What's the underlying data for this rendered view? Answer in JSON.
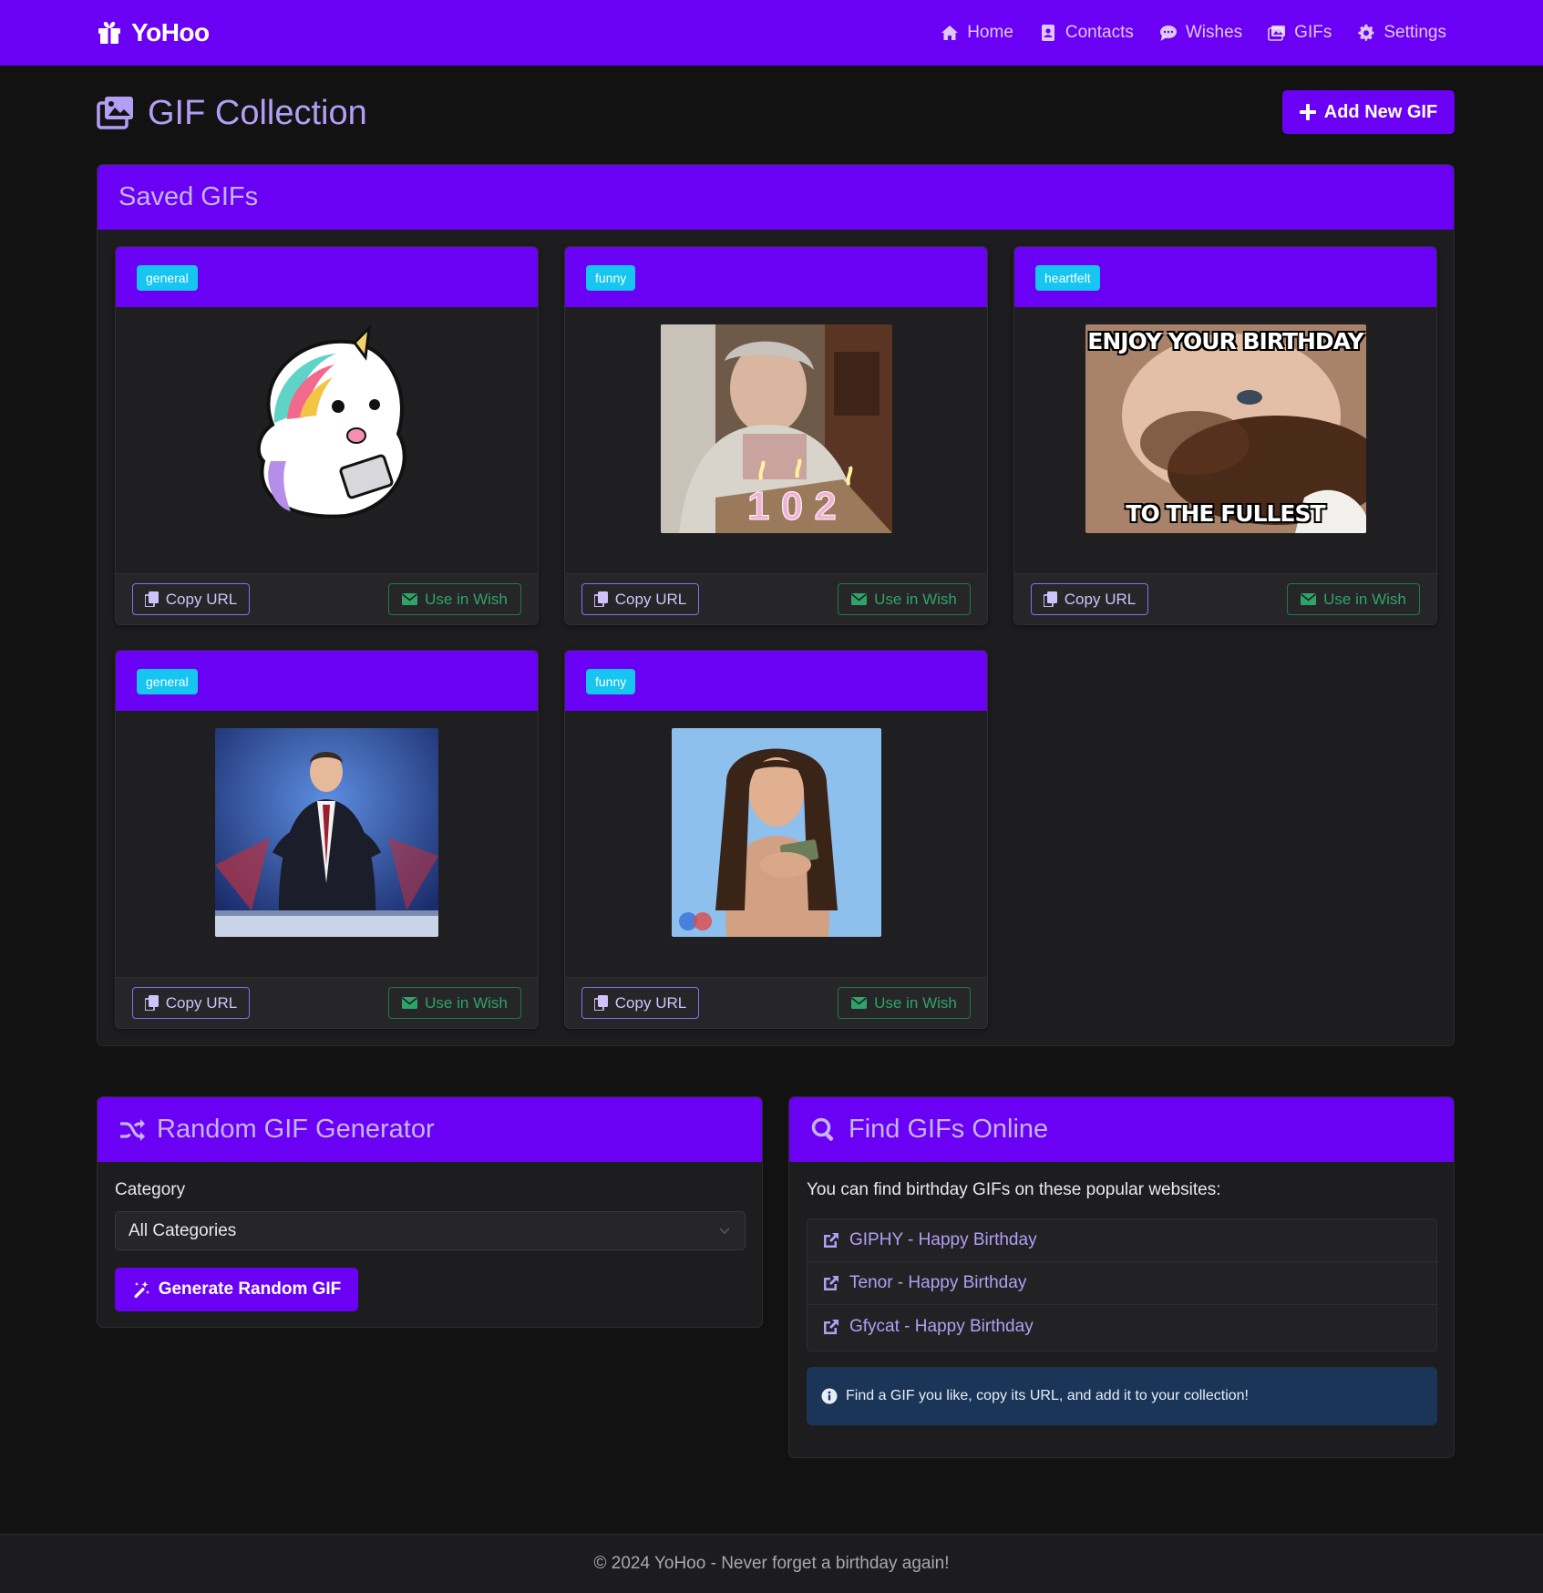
{
  "app": {
    "brand": "YoHoo",
    "brand_icon": "gift-icon"
  },
  "nav": {
    "items": [
      {
        "label": "Home",
        "icon": "home-icon"
      },
      {
        "label": "Contacts",
        "icon": "address-book-icon"
      },
      {
        "label": "Wishes",
        "icon": "comment-icon"
      },
      {
        "label": "GIFs",
        "icon": "images-icon"
      },
      {
        "label": "Settings",
        "icon": "gear-icon"
      }
    ]
  },
  "page": {
    "title": "GIF Collection",
    "add_button": "Add New GIF"
  },
  "saved": {
    "title": "Saved GIFs",
    "gifs": [
      {
        "category": "general",
        "image": "unicorn-with-laptop-sticker",
        "copy_label": "Copy URL",
        "use_label": "Use in Wish"
      },
      {
        "category": "funny",
        "image": "grandma-102-birthday-candles",
        "copy_label": "Copy URL",
        "use_label": "Use in Wish"
      },
      {
        "category": "heartfelt",
        "image": "baby-eating-cake-meme",
        "caption_top": "ENJOY YOUR BIRTHDAY",
        "caption_bottom": "TO THE FULLEST",
        "copy_label": "Copy URL",
        "use_label": "Use in Wish"
      },
      {
        "category": "general",
        "image": "man-in-suit-on-stage",
        "copy_label": "Copy URL",
        "use_label": "Use in Wish"
      },
      {
        "category": "funny",
        "image": "woman-holding-money",
        "copy_label": "Copy URL",
        "use_label": "Use in Wish"
      }
    ]
  },
  "random": {
    "title": "Random GIF Generator",
    "category_label": "Category",
    "category_value": "All Categories",
    "generate_label": "Generate Random GIF"
  },
  "find": {
    "title": "Find GIFs Online",
    "intro": "You can find birthday GIFs on these popular websites:",
    "links": [
      {
        "label": "GIPHY - Happy Birthday"
      },
      {
        "label": "Tenor - Happy Birthday"
      },
      {
        "label": "Gfycat - Happy Birthday"
      }
    ],
    "info": "Find a GIF you like, copy its URL, and add it to your collection!"
  },
  "footer": {
    "text": "© 2024 YoHoo - Never forget a birthday again!"
  },
  "colors": {
    "primary": "#6a00f4",
    "badge": "#16c5f0",
    "success": "#2fa36a",
    "info_bg": "#1a3557"
  }
}
